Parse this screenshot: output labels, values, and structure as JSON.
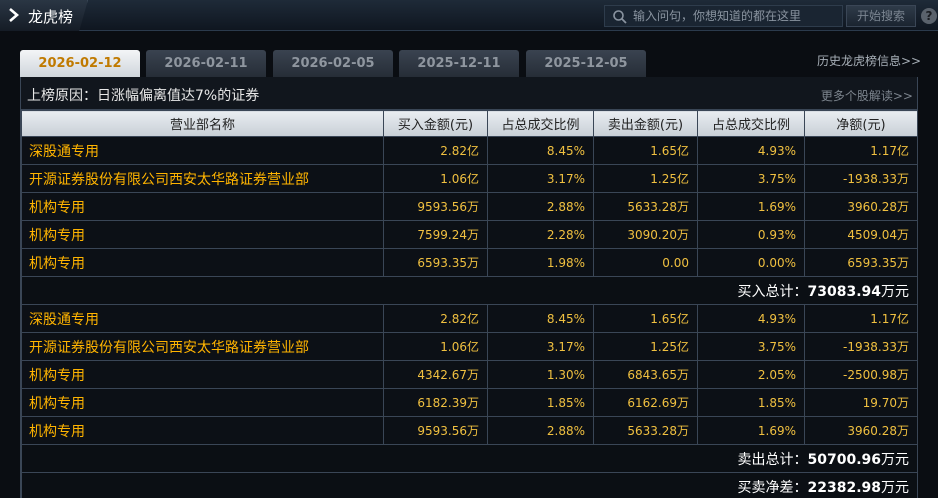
{
  "header": {
    "title": "龙虎榜",
    "search_placeholder": "输入问句，你想知道的都在这里",
    "search_button": "开始搜索",
    "help_label": "?"
  },
  "tabs": [
    {
      "label": "2026-02-12",
      "active": true
    },
    {
      "label": "2026-02-11",
      "active": false
    },
    {
      "label": "2026-02-05",
      "active": false
    },
    {
      "label": "2025-12-11",
      "active": false
    },
    {
      "label": "2025-12-05",
      "active": false
    }
  ],
  "history_link": "历史龙虎榜信息>>",
  "reason": "上榜原因：日涨幅偏离值达7%的证券",
  "more_link": "更多个股解读>>",
  "columns": [
    "营业部名称",
    "买入金额(元)",
    "占总成交比例",
    "卖出金额(元)",
    "占总成交比例",
    "净额(元)"
  ],
  "buy_rows": [
    [
      "深股通专用",
      "2.82亿",
      "8.45%",
      "1.65亿",
      "4.93%",
      "1.17亿"
    ],
    [
      "开源证券股份有限公司西安太华路证券营业部",
      "1.06亿",
      "3.17%",
      "1.25亿",
      "3.75%",
      "-1938.33万"
    ],
    [
      "机构专用",
      "9593.56万",
      "2.88%",
      "5633.28万",
      "1.69%",
      "3960.28万"
    ],
    [
      "机构专用",
      "7599.24万",
      "2.28%",
      "3090.20万",
      "0.93%",
      "4509.04万"
    ],
    [
      "机构专用",
      "6593.35万",
      "1.98%",
      "0.00",
      "0.00%",
      "6593.35万"
    ]
  ],
  "buy_total": {
    "label": "买入总计：",
    "value": "73083.94",
    "unit": "万元"
  },
  "sell_rows": [
    [
      "深股通专用",
      "2.82亿",
      "8.45%",
      "1.65亿",
      "4.93%",
      "1.17亿"
    ],
    [
      "开源证券股份有限公司西安太华路证券营业部",
      "1.06亿",
      "3.17%",
      "1.25亿",
      "3.75%",
      "-1938.33万"
    ],
    [
      "机构专用",
      "4342.67万",
      "1.30%",
      "6843.65万",
      "2.05%",
      "-2500.98万"
    ],
    [
      "机构专用",
      "6182.39万",
      "1.85%",
      "6162.69万",
      "1.85%",
      "19.70万"
    ],
    [
      "机构专用",
      "9593.56万",
      "2.88%",
      "5633.28万",
      "1.69%",
      "3960.28万"
    ]
  ],
  "sell_total": {
    "label": "卖出总计：",
    "value": "50700.96",
    "unit": "万元"
  },
  "net_total": {
    "label": "买卖净差：",
    "value": "22382.98",
    "unit": "万元"
  },
  "colors": {
    "accent": "#ffb400",
    "number": "#f0c040",
    "active_tab_text": "#c07a00"
  }
}
